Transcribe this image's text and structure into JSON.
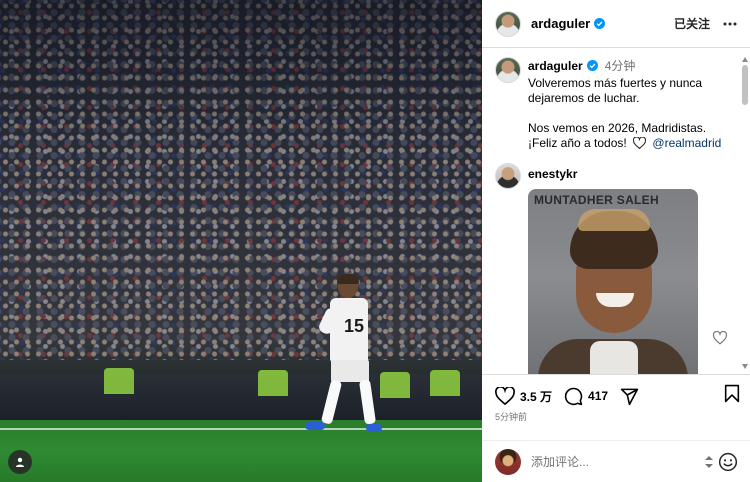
{
  "post": {
    "author": "ardaguler",
    "follow_state": "已关注",
    "jersey_number": "15"
  },
  "caption": {
    "username": "ardaguler",
    "time": "4分钟",
    "text": "Volveremos más fuertes y nunca dejaremos de luchar.",
    "text2_line1": "Nos vemos en 2026, Madridistas.",
    "text2_line2": "¡Feliz año a todos!",
    "mention": "@realmadrid"
  },
  "comments": [
    {
      "username": "enestykr",
      "gif_caption": "MUNTADHER SALEH"
    }
  ],
  "actions": {
    "likes": "3.5 万",
    "comments": "417",
    "posted_ago": "5分钟前"
  },
  "add_comment": {
    "placeholder": "添加评论..."
  },
  "colors": {
    "verified_blue": "#0095f6",
    "mention_blue": "#00376b",
    "muted_text": "#737373",
    "divider": "#dbdbdb"
  },
  "icons": {
    "verified": "verified-badge-icon",
    "more": "more-horizontal-icon",
    "like": "heart-icon",
    "comment": "comment-bubble-icon",
    "share": "paper-plane-icon",
    "save": "bookmark-icon",
    "emoji": "emoji-smile-icon",
    "tag": "user-tag-icon"
  }
}
